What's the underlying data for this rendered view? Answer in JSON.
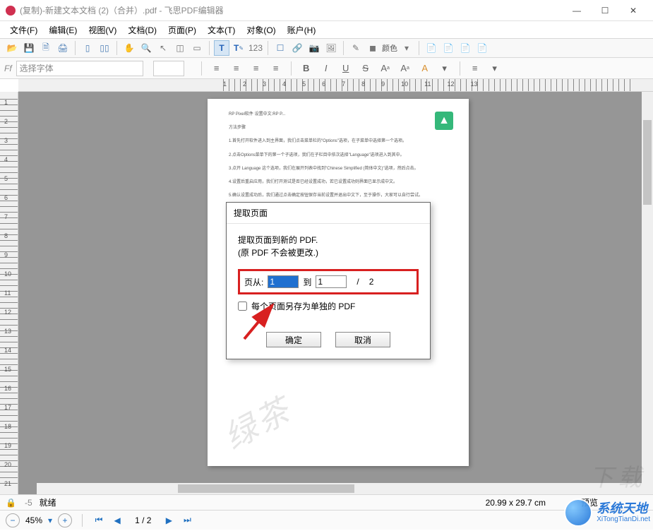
{
  "window": {
    "title": "(复制)-新建文本文档 (2)（合并）.pdf - 飞思PDF编辑器"
  },
  "menu": {
    "file": "文件(F)",
    "edit": "编辑(E)",
    "view": "视图(V)",
    "doc": "文档(D)",
    "page": "页面(P)",
    "text": "文本(T)",
    "object": "对象(O)",
    "account": "账户(H)"
  },
  "format": {
    "font_placeholder": "选择字体",
    "color_label": "颜色"
  },
  "dialog": {
    "title": "提取页面",
    "line1": "提取页面到新的 PDF.",
    "line2": "(原 PDF 不会被更改.)",
    "from_label": "页从:",
    "from_value": "1",
    "to_label": "到",
    "to_value": "1",
    "sep": "/",
    "total": "2",
    "checkbox_label": "每个页面另存为单独的 PDF",
    "ok": "确定",
    "cancel": "取消"
  },
  "status": {
    "ready": "就绪",
    "dims": "20.99 x 29.7 cm",
    "preview": "预览"
  },
  "footer": {
    "zoom": "45%",
    "page": "1 / 2"
  },
  "brand": {
    "cn": "系统天地",
    "en": "XiTongTianDi.net"
  }
}
